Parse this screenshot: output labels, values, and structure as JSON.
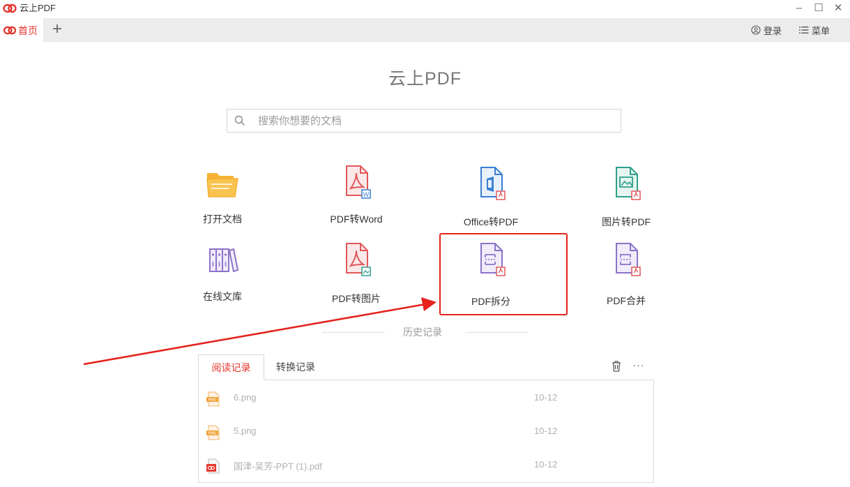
{
  "window": {
    "title": "云上PDF",
    "controls": {
      "minimize": "–",
      "maximize": "☐",
      "close": "✕"
    }
  },
  "tabs": {
    "home_label": "首页",
    "add": "+"
  },
  "header_actions": {
    "login_label": "登录",
    "menu_label": "菜单"
  },
  "main": {
    "title": "云上PDF",
    "search_placeholder": "搜索你想要的文档"
  },
  "features": [
    {
      "label": "打开文档",
      "icon": "folder-icon"
    },
    {
      "label": "PDF转Word",
      "icon": "pdf-to-word-icon"
    },
    {
      "label": "Office转PDF",
      "icon": "office-to-pdf-icon"
    },
    {
      "label": "图片转PDF",
      "icon": "image-to-pdf-icon"
    },
    {
      "label": "在线文库",
      "icon": "library-icon"
    },
    {
      "label": "PDF转图片",
      "icon": "pdf-to-image-icon"
    },
    {
      "label": "PDF拆分",
      "icon": "pdf-split-icon"
    },
    {
      "label": "PDF合并",
      "icon": "pdf-merge-icon"
    }
  ],
  "history": {
    "section_label": "历史记录",
    "tabs": [
      "阅读记录",
      "转换记录"
    ],
    "more": "···",
    "items": [
      {
        "name": "6.png",
        "date": "10-12",
        "type": "png"
      },
      {
        "name": "5.png",
        "date": "10-12",
        "type": "png"
      },
      {
        "name": "国津-吴芳-PPT (1).pdf",
        "date": "10-12",
        "type": "pdf"
      }
    ]
  },
  "colors": {
    "accent": "#e5352c",
    "highlight": "#e5221c",
    "folder": "#f5b335",
    "pdf_red": "#e0575a",
    "office_blue": "#3a7fd5",
    "image_green": "#2e9f8a",
    "purple": "#8c72c9"
  }
}
